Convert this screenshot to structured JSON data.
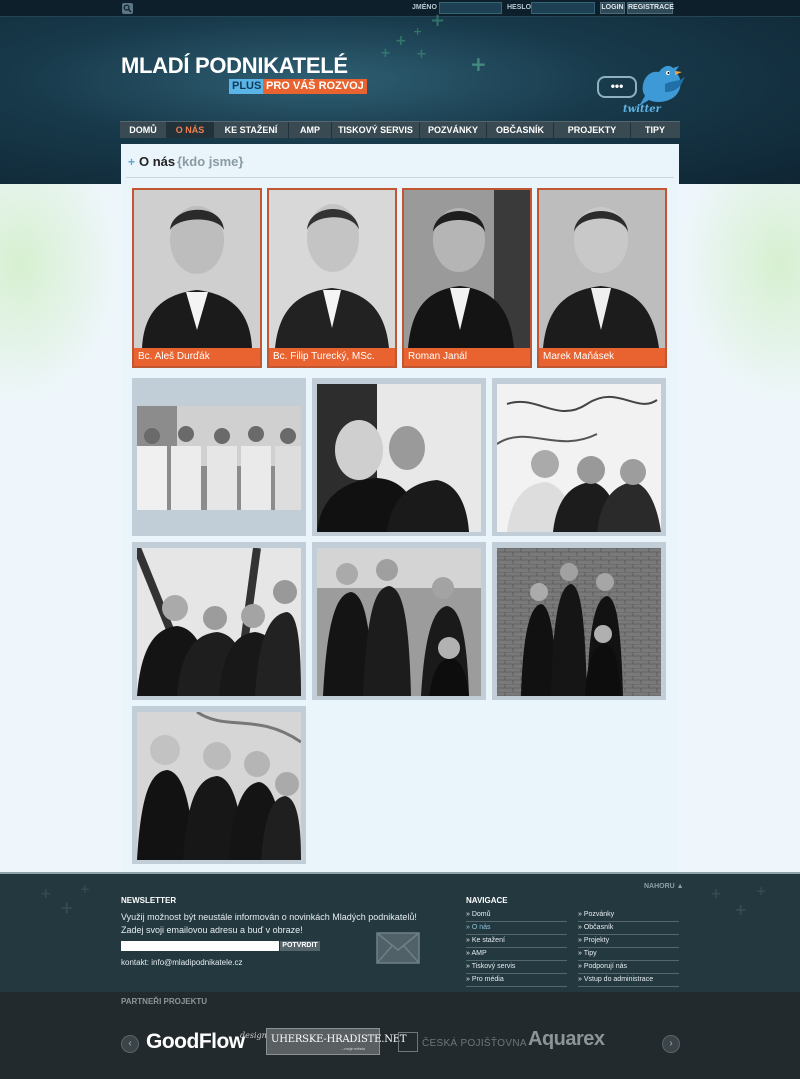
{
  "topbar": {
    "name_label": "JMÉNO",
    "password_label": "HESLO",
    "login_label": "LOGIN",
    "register_label": "REGISTRACE",
    "search_icon": "search-icon"
  },
  "logo": {
    "title": "MLADÍ PODNIKATELÉ",
    "plus": "PLUS",
    "subtitle": "PRO VÁŠ ROZVOJ"
  },
  "twitter": {
    "bubble": "•••",
    "word": "twitter"
  },
  "nav": {
    "items": [
      {
        "label": "DOMŮ"
      },
      {
        "label": "O NÁS"
      },
      {
        "label": "KE STAŽENÍ"
      },
      {
        "label": "AMP"
      },
      {
        "label": "TISKOVÝ SERVIS"
      },
      {
        "label": "POZVÁNKY"
      },
      {
        "label": "OBČASNÍK"
      },
      {
        "label": "PROJEKTY"
      },
      {
        "label": "TIPY"
      }
    ],
    "active_index": 1
  },
  "page": {
    "title": "O nás",
    "subtitle": "{kdo jsme}"
  },
  "people": [
    {
      "name": "Bc. Aleš Durďák"
    },
    {
      "name": "Bc. Filip Turecký, MSc."
    },
    {
      "name": "Roman Janál"
    },
    {
      "name": "Marek Maňásek"
    }
  ],
  "gallery_count": 7,
  "footer": {
    "nahoru": "NAHORU ▲",
    "newsletter_title": "NEWSLETTER",
    "newsletter_text_1": "Využij možnost být neustále informován o novinkách Mladých podnikatelů!",
    "newsletter_text_2": "Zadej svoji emailovou adresu a buď v obraze!",
    "newsletter_input_value": "",
    "newsletter_button": "POTVRDIT",
    "contact": "kontakt: info@mladipodnikatele.cz",
    "nav_title": "NAVIGACE",
    "nav_col1": [
      "» Domů",
      "» O nás",
      "» Ke stažení",
      "» AMP",
      "» Tiskový servis",
      "» Pro média"
    ],
    "nav_col2": [
      "» Pozvánky",
      "» Občasník",
      "» Projekty",
      "» Tipy",
      "» Podporují nás",
      "» Vstup do administrace"
    ],
    "active_link": "» O nás"
  },
  "partners": {
    "title": "PARTNEŘI PROJEKTU",
    "prev": "‹",
    "next": "›",
    "goodflow": "GoodFlow",
    "goodflow_small": "design",
    "uherske": "UHERSKE-HRADISTE.NET",
    "uherske_small": "...moje město",
    "ceska": "ČESKÁ POJIŠŤOVNA",
    "aquarex": "Aquarex"
  },
  "colors": {
    "accent_orange": "#e8632f",
    "accent_blue": "#5bb4e6",
    "header_dark": "#17394a",
    "footer_dark": "#24383f"
  }
}
